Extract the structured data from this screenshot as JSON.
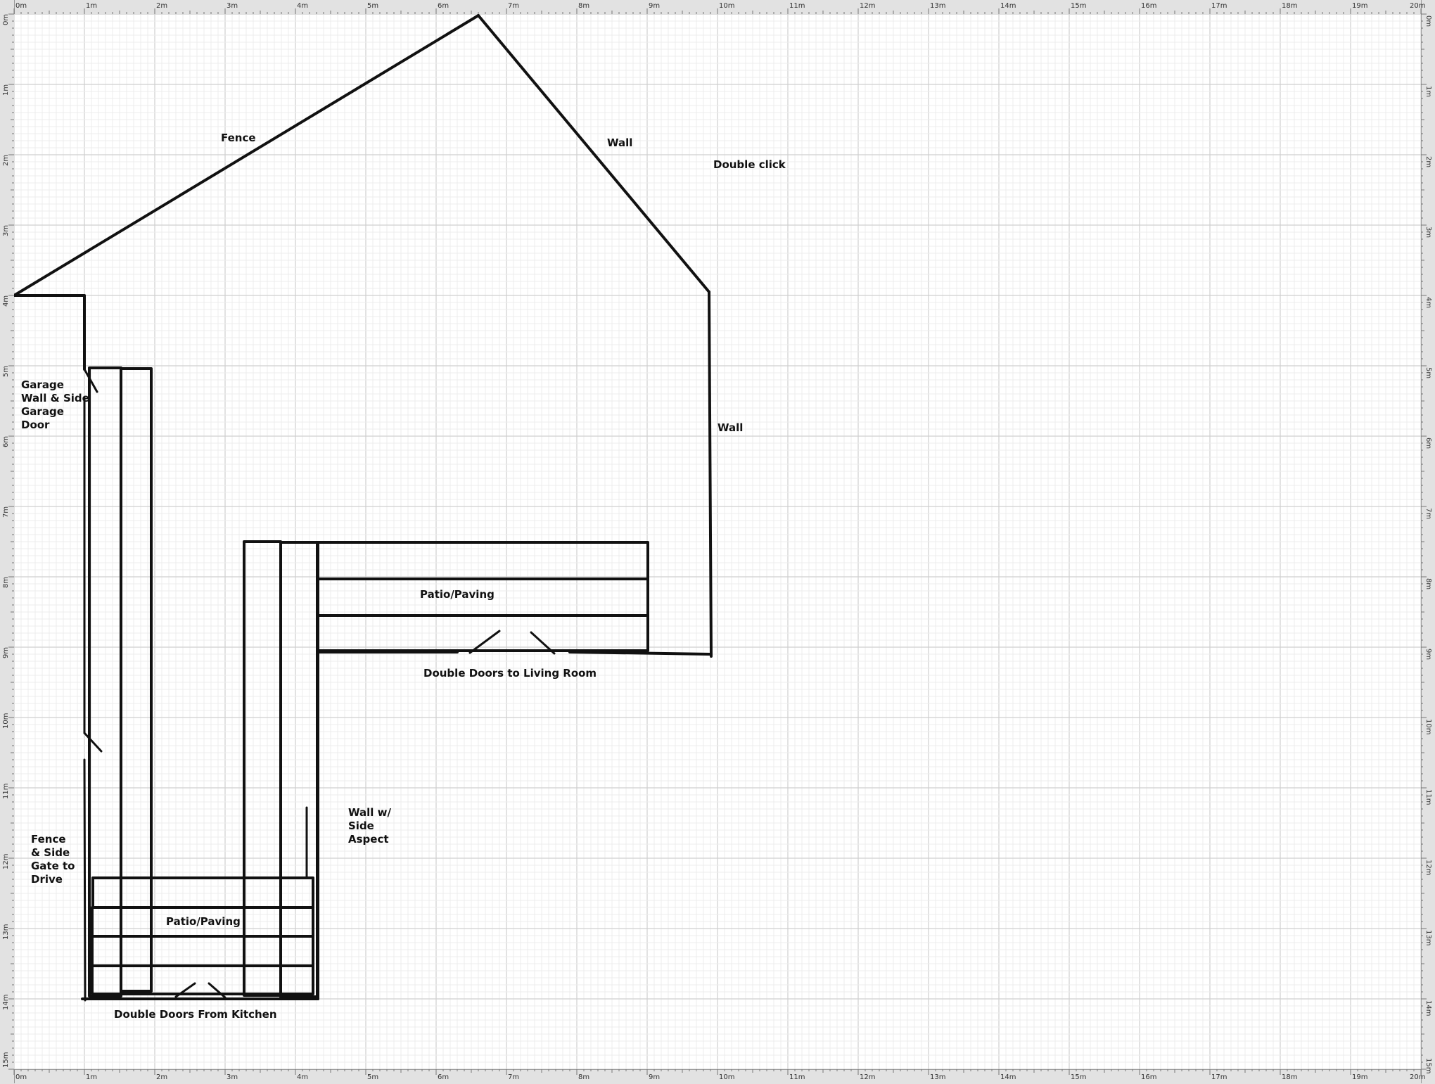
{
  "rulers": {
    "horizontal_labels": [
      "0m",
      "1m",
      "2m",
      "3m",
      "4m",
      "5m",
      "6m",
      "7m",
      "8m",
      "9m",
      "10m",
      "11m",
      "12m",
      "13m",
      "14m",
      "15m",
      "16m",
      "17m",
      "18m",
      "19m",
      "20m"
    ],
    "vertical_labels": [
      "0m",
      "1m",
      "2m",
      "3m",
      "4m",
      "5m",
      "6m",
      "7m",
      "8m",
      "9m",
      "10m",
      "11m",
      "12m",
      "13m",
      "14m",
      "15m"
    ]
  },
  "colors": {
    "grid_minor": "#ececec",
    "grid_major": "#cfcfcf",
    "line": "#111111",
    "canvas": "#ffffff",
    "ruler": "#e2e2e2"
  },
  "labels": {
    "fence": "Fence",
    "wall_top": "Wall",
    "double_click": "Double click",
    "wall_right": "Wall",
    "garage": [
      "Garage",
      "Wall & Side",
      "Garage",
      "Door"
    ],
    "patio_upper": "Patio/Paving",
    "doors_living": "Double Doors to Living Room",
    "wall_side": [
      "Wall w/",
      "Side",
      "Aspect"
    ],
    "fence_gate": [
      "Fence",
      "& Side",
      "Gate to",
      "Drive"
    ],
    "patio_lower": "Patio/Paving",
    "doors_kitchen": "Double Doors From Kitchen"
  }
}
